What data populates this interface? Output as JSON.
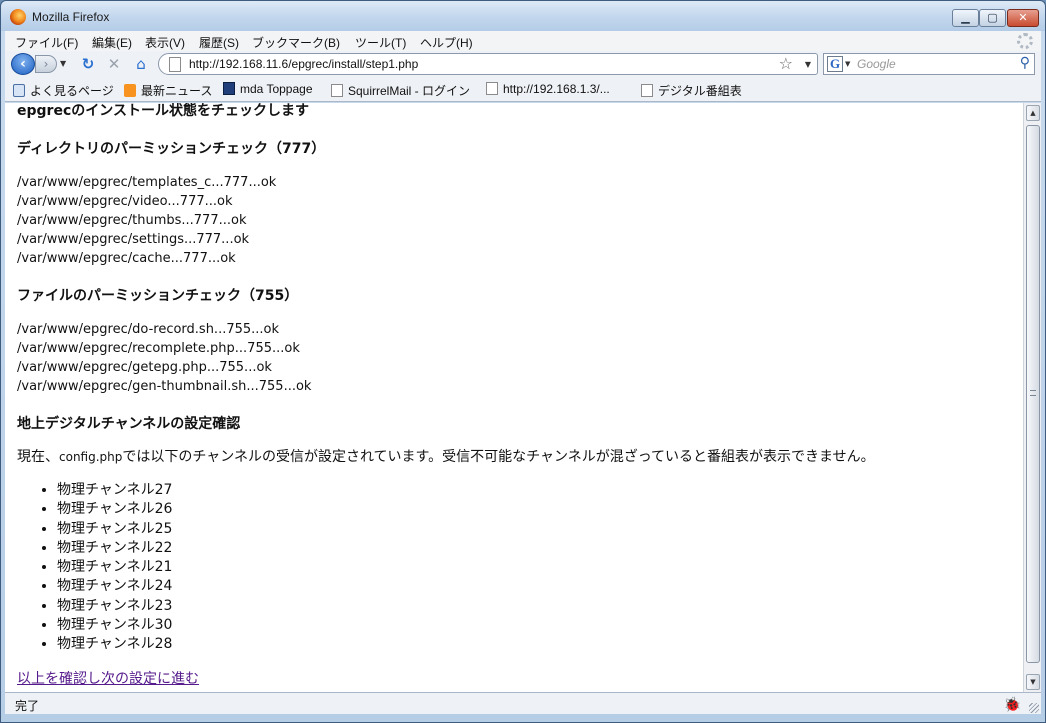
{
  "window": {
    "title": "Mozilla Firefox",
    "min": "▁",
    "max": "▢",
    "close": "✕"
  },
  "menu": [
    "ファイル(F)",
    "編集(E)",
    "表示(V)",
    "履歴(S)",
    "ブックマーク(B)",
    "ツール(T)",
    "ヘルプ(H)"
  ],
  "nav": {
    "url": "http://192.168.11.6/epgrec/install/step1.php",
    "search_placeholder": "Google",
    "search_engine_letter": "G"
  },
  "bookmarks": [
    "よく見るページ",
    "最新ニュース",
    "mda Toppage",
    "SquirrelMail - ログイン",
    "http://192.168.1.3/...",
    "デジタル番組表"
  ],
  "page": {
    "heading": "epgrecのインストール状態をチェックします",
    "dir_heading": "ディレクトリのパーミッションチェック（777）",
    "dirs": [
      "/var/www/epgrec/templates_c...777...ok",
      "/var/www/epgrec/video...777...ok",
      "/var/www/epgrec/thumbs...777...ok",
      "/var/www/epgrec/settings...777...ok",
      "/var/www/epgrec/cache...777...ok"
    ],
    "file_heading": "ファイルのパーミッションチェック（755）",
    "files": [
      "/var/www/epgrec/do-record.sh...755...ok",
      "/var/www/epgrec/recomplete.php...755...ok",
      "/var/www/epgrec/getepg.php...755...ok",
      "/var/www/epgrec/gen-thumbnail.sh...755...ok"
    ],
    "channel_heading": "地上デジタルチャンネルの設定確認",
    "para_pre": "現在、",
    "para_file": "config.php",
    "para_post": "では以下のチャンネルの受信が設定されています。受信不可能なチャンネルが混ざっていると番組表が表示できません。",
    "channels": [
      "物理チャンネル27",
      "物理チャンネル26",
      "物理チャンネル25",
      "物理チャンネル22",
      "物理チャンネル21",
      "物理チャンネル24",
      "物理チャンネル23",
      "物理チャンネル30",
      "物理チャンネル28"
    ],
    "next_link": "以上を確認し次の設定に進む"
  },
  "status": "完了"
}
